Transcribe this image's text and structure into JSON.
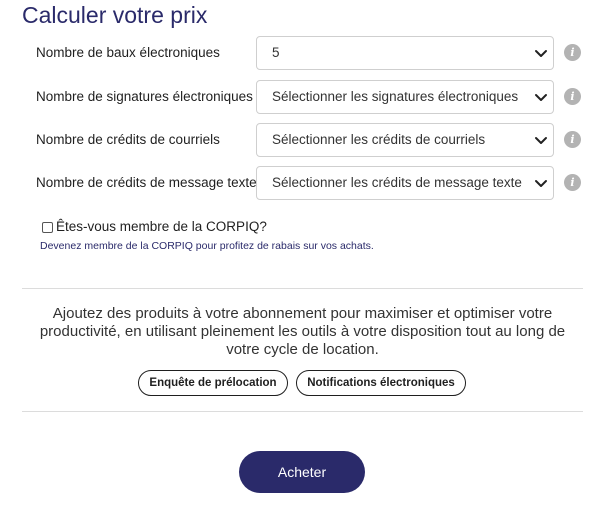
{
  "title": "Calculer votre prix",
  "fields": [
    {
      "label": "Nombre de baux électroniques",
      "value": "5"
    },
    {
      "label": "Nombre de signatures électroniques",
      "value": "Sélectionner les signatures électroniques"
    },
    {
      "label": "Nombre de crédits de courriels",
      "value": "Sélectionner les crédits de courriels"
    },
    {
      "label": "Nombre de crédits de message texte",
      "value": "Sélectionner les crédits de message texte"
    }
  ],
  "info_icon_glyph": "i",
  "member": {
    "checked": false,
    "label": "Êtes-vous membre de la CORPIQ?",
    "note": "Devenez membre de la CORPIQ pour profitez de rabais sur vos achats."
  },
  "promo": {
    "text": "Ajoutez des produits à votre abonnement pour maximiser et optimiser votre productivité, en utilisant pleinement les outils à votre disposition tout au long de votre cycle de location.",
    "buttons": [
      "Enquête de prélocation",
      "Notifications électroniques"
    ]
  },
  "submit_label": "Acheter",
  "colors": {
    "brand": "#2a2a6a",
    "info_icon": "#b3b3b3",
    "border": "#cfcfcf",
    "divider": "#dcdcdc"
  }
}
